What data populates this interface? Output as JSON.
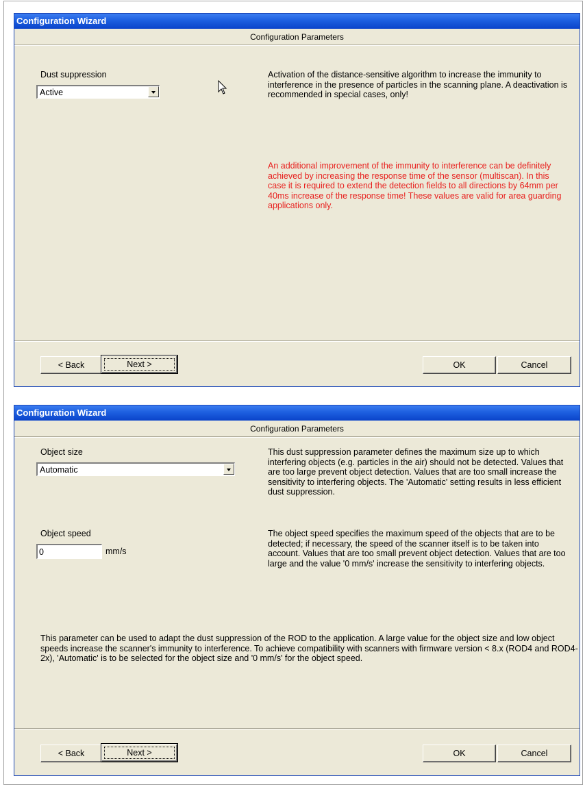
{
  "dialogs": [
    {
      "title": "Configuration Wizard",
      "header": "Configuration Parameters",
      "field_label": "Dust suppression",
      "combo_value": "Active",
      "description": "Activation of the distance-sensitive algorithm to increase the immunity to interference in the presence of particles in the scanning plane. A deactivation is recommended in special cases, only!",
      "warning": "An additional improvement of the immunity to interference can be definitely achieved by increasing the response time of the sensor (multiscan). In this case it is required to extend the detection fields to all directions by 64mm per 40ms increase of the response time! These values are valid for area guarding applications only.",
      "buttons": {
        "back": "< Back",
        "next": "Next >",
        "ok": "OK",
        "cancel": "Cancel"
      }
    },
    {
      "title": "Configuration Wizard",
      "header": "Configuration Parameters",
      "object_size_label": "Object size",
      "object_size_value": "Automatic",
      "object_size_description": "This dust suppression parameter defines the maximum size up to which interfering objects (e.g. particles in the air) should not be detected. Values that are too large prevent object detection. Values that are too small increase the sensitivity to interfering objects. The 'Automatic' setting results in less efficient dust suppression.",
      "object_speed_label": "Object speed",
      "object_speed_value": "0",
      "object_speed_unit": "mm/s",
      "object_speed_description": "The object speed specifies the maximum speed of the objects that are to be detected; if necessary, the speed of the scanner itself is to be taken into account. Values that are too small prevent object detection. Values that are too large and the value '0 mm/s' increase the sensitivity to interfering objects.",
      "note": "This parameter can be used to adapt the dust suppression of the ROD to the application. A large value for the object size and low object speeds increase the scanner's immunity to interference. To achieve compatibility with scanners with firmware version < 8.x (ROD4 and ROD4-2x), 'Automatic' is to be selected for the object size and '0 mm/s' for the object speed.",
      "buttons": {
        "back": "< Back",
        "next": "Next >",
        "ok": "OK",
        "cancel": "Cancel"
      }
    }
  ],
  "colors": {
    "titlebar": "#0a43c9",
    "dialog_bg": "#ece9d8",
    "warning_text": "#e8201e"
  },
  "icons": {
    "cursor": "arrow-cursor-icon",
    "dropdown": "chevron-down-icon"
  }
}
